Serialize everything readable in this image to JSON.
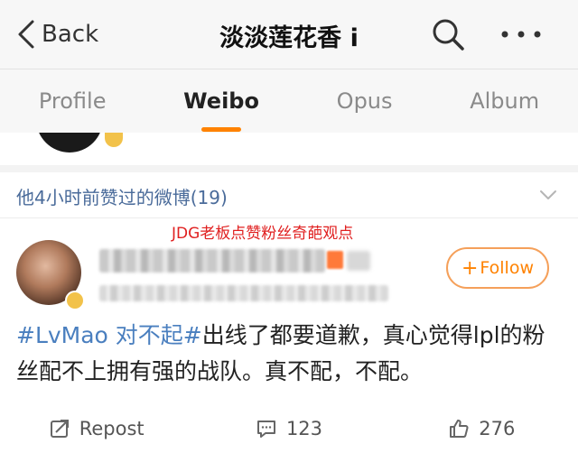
{
  "nav": {
    "back_label": "Back",
    "title": "淡淡莲花香 i"
  },
  "tabs": [
    {
      "label": "Profile",
      "active": false
    },
    {
      "label": "Weibo",
      "active": true
    },
    {
      "label": "Opus",
      "active": false
    },
    {
      "label": "Album",
      "active": false
    }
  ],
  "liked_section": {
    "label": "他4小时前赞过的微博(19)"
  },
  "annotation": "JDG老板点赞粉丝奇葩观点",
  "post": {
    "follow_label": "Follow",
    "hashtag": "#LvMao 对不起#",
    "text": "出线了都要道歉，真心觉得lpl的粉丝配不上拥有强的战队。真不配，不配。"
  },
  "actions": {
    "repost_label": "Repost",
    "comments_count": "123",
    "likes_count": "276"
  },
  "colors": {
    "accent": "#ff8200",
    "link": "#4a7fbf",
    "annotation": "#e02020"
  }
}
